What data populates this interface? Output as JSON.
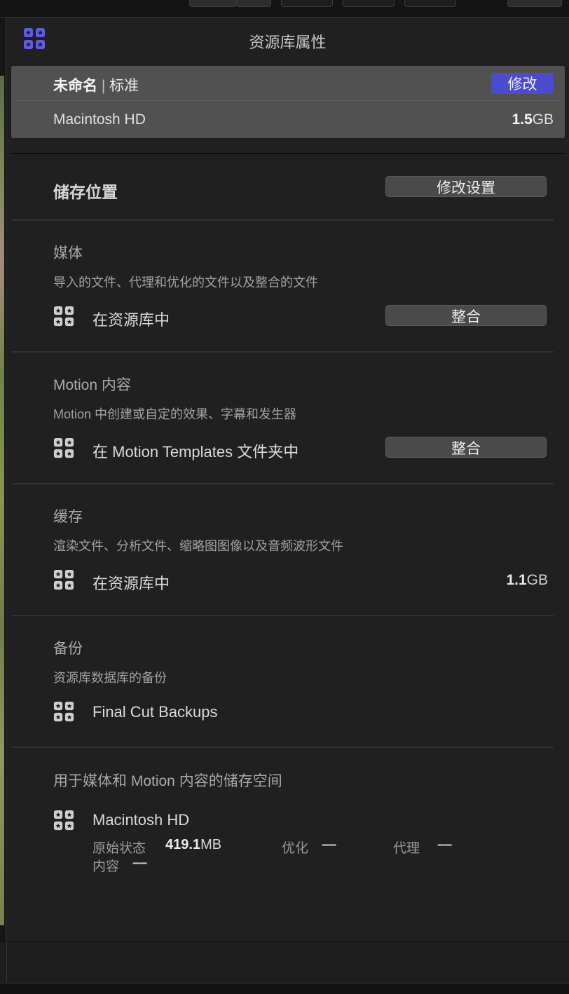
{
  "panel": {
    "title": "资源库属性",
    "icon_color": "#5d5ee3"
  },
  "summary": {
    "library_name": "未命名",
    "separator": "|",
    "library_type": "标准",
    "modify_label": "修改",
    "disk_name": "Macintosh HD",
    "size_value": "1.5",
    "size_unit": "GB"
  },
  "storage": {
    "title": "储存位置",
    "modify_settings_label": "修改设置"
  },
  "sections": {
    "media": {
      "title": "媒体",
      "description": "导入的文件、代理和优化的文件以及整合的文件",
      "location": "在资源库中",
      "button_label": "整合"
    },
    "motion": {
      "title": "Motion 内容",
      "description": "Motion 中创建或自定的效果、字幕和发生器",
      "location": "在 Motion Templates 文件夹中",
      "button_label": "整合"
    },
    "cache": {
      "title": "缓存",
      "description": "渲染文件、分析文件、缩略图图像以及音频波形文件",
      "location": "在资源库中",
      "size_value": "1.1",
      "size_unit": "GB"
    },
    "backup": {
      "title": "备份",
      "description": "资源库数据库的备份",
      "location": "Final Cut Backups"
    },
    "space": {
      "title": "用于媒体和 Motion 内容的储存空间",
      "disk_name": "Macintosh HD",
      "original_label": "原始状态",
      "original_value": "419.1",
      "original_unit": "MB",
      "optimized_label": "优化",
      "optimized_value": "––",
      "proxy_label": "代理",
      "proxy_value": "––",
      "content_label": "内容",
      "content_value": "––"
    }
  }
}
